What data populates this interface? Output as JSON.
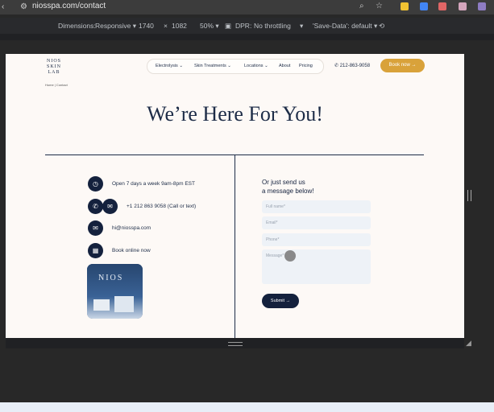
{
  "browser": {
    "url": "niosspa.com/contact"
  },
  "devtools": {
    "dimensions_label": "Dimensions:",
    "dimensions_mode": "Responsive",
    "width": "1740",
    "times": "×",
    "height": "1082",
    "zoom": "50%",
    "dpr_label": "DPR:",
    "throttling": "No throttling",
    "save_data": "'Save-Data': default"
  },
  "site": {
    "logo_lines": [
      "NIOS",
      "SKIN",
      "LAB"
    ],
    "nav": [
      "Electrolysis",
      "Skin Treatments",
      "Locations",
      "About",
      "Pricing"
    ],
    "phone": "212-863-9058",
    "book_button": "Book now →",
    "breadcrumb": "Home | Contact",
    "hero_title": "We’re Here For You!",
    "contact": {
      "hours": "Open 7 days a week 9am-8pm EST",
      "phone": "+1 212 863 9058 (Call or text)",
      "email": "hi@niosspa.com",
      "book_online": "Book online now",
      "photo_text": "NIOS"
    },
    "form": {
      "title_line1": "Or just send us",
      "title_line2": "a message below!",
      "full_name": "Full name*",
      "email": "Email*",
      "phone": "Phone*",
      "message": "Message*",
      "submit": "Submit →"
    }
  },
  "colors": {
    "navy": "#14213d",
    "gold": "#d9a23a",
    "page_bg": "#fdf9f6"
  }
}
